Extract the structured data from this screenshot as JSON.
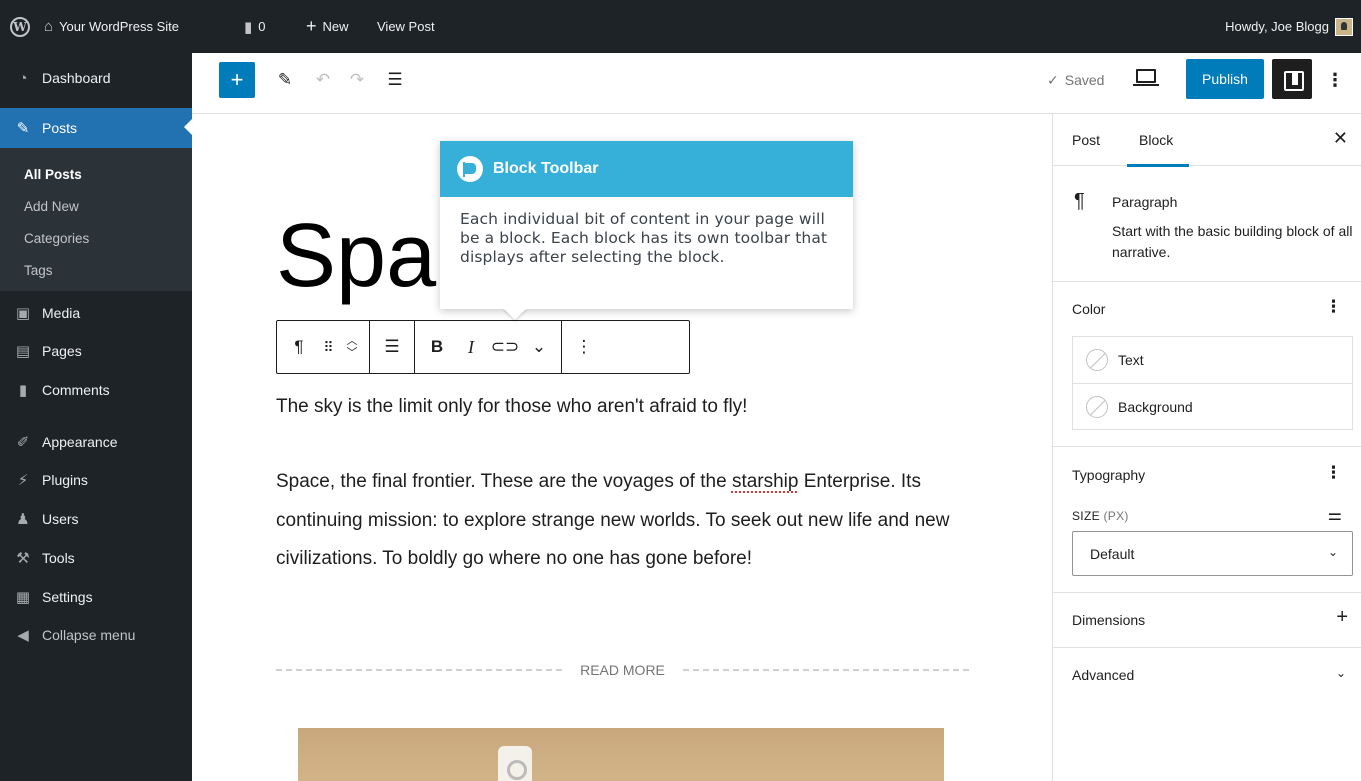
{
  "adminbar": {
    "wp_logo": "W",
    "site_name": "Your WordPress Site",
    "comment_count": "0",
    "new_label": "New",
    "view_post": "View Post",
    "howdy": "Howdy, Joe Blogg",
    "icons": [
      "wordpress-logo-icon",
      "home-icon",
      "comment-bubble-icon",
      "plus-icon",
      "avatar"
    ]
  },
  "admin_menu": {
    "dashboard": "Dashboard",
    "posts": "Posts",
    "submenu": [
      "All Posts",
      "Add New",
      "Categories",
      "Tags"
    ],
    "media": "Media",
    "pages": "Pages",
    "comments": "Comments",
    "appearance": "Appearance",
    "plugins": "Plugins",
    "users": "Users",
    "tools": "Tools",
    "settings": "Settings",
    "collapse": "Collapse menu",
    "active_color": "#2271b1"
  },
  "editor_toolbar": {
    "saved": "Saved",
    "publish": "Publish",
    "accent": "#007cba"
  },
  "post": {
    "title_visible": "Spa",
    "tagline": "The sky is the limit only for those who aren't afraid to fly!",
    "body_before": "Space, the final frontier. These are the voyages of the ",
    "body_misspelled": "starship",
    "body_after": " Enterprise. Its continuing mission: to explore strange new worlds. To seek out new life and new civilizations. To boldly go where no one has gone before!",
    "read_more": "READ MORE"
  },
  "tooltip": {
    "title": "Block Toolbar",
    "body": "Each individual bit of content in your page will be a block. Each block has its own toolbar that displays after selecting the block.",
    "header_color": "#36b0d9"
  },
  "settings_sidebar": {
    "tab_post": "Post",
    "tab_block": "Block",
    "block_name": "Paragraph",
    "block_desc": "Start with the basic building block of all narrative.",
    "color_heading": "Color",
    "color_text": "Text",
    "color_background": "Background",
    "typography_heading": "Typography",
    "size_label": "SIZE",
    "size_unit": "(PX)",
    "size_value": "Default",
    "dimensions": "Dimensions",
    "advanced": "Advanced"
  }
}
